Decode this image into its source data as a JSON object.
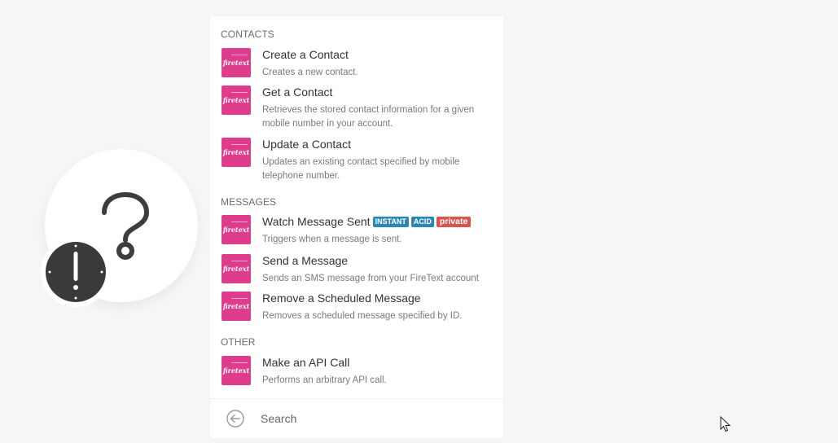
{
  "sections": [
    {
      "title": "CONTACTS",
      "items": [
        {
          "title": "Create a Contact",
          "description": "Creates a new contact."
        },
        {
          "title": "Get a Contact",
          "description": "Retrieves the stored contact information for a given mobile number in your account."
        },
        {
          "title": "Update a Contact",
          "description": "Updates an existing contact specified by mobile telephone number."
        }
      ]
    },
    {
      "title": "MESSAGES",
      "items": [
        {
          "title": "Watch Message Sent",
          "description": "Triggers when a message is sent.",
          "badges": [
            "INSTANT",
            "ACID",
            "private"
          ]
        },
        {
          "title": "Send a Message",
          "description": "Sends an SMS message from your FireText account"
        },
        {
          "title": "Remove a Scheduled Message",
          "description": "Removes a scheduled message specified by ID."
        }
      ]
    },
    {
      "title": "OTHER",
      "items": [
        {
          "title": "Make an API Call",
          "description": "Performs an arbitrary API call."
        }
      ]
    }
  ],
  "logo_text": "firetext",
  "search": {
    "placeholder": "Search"
  },
  "colors": {
    "brand": "#e03c8d",
    "instant_badge": "#2a88b6",
    "private_badge": "#d9534f"
  },
  "icons": {
    "module": "question-mark-icon",
    "trigger": "clock-icon",
    "back": "back-arrow-icon"
  }
}
